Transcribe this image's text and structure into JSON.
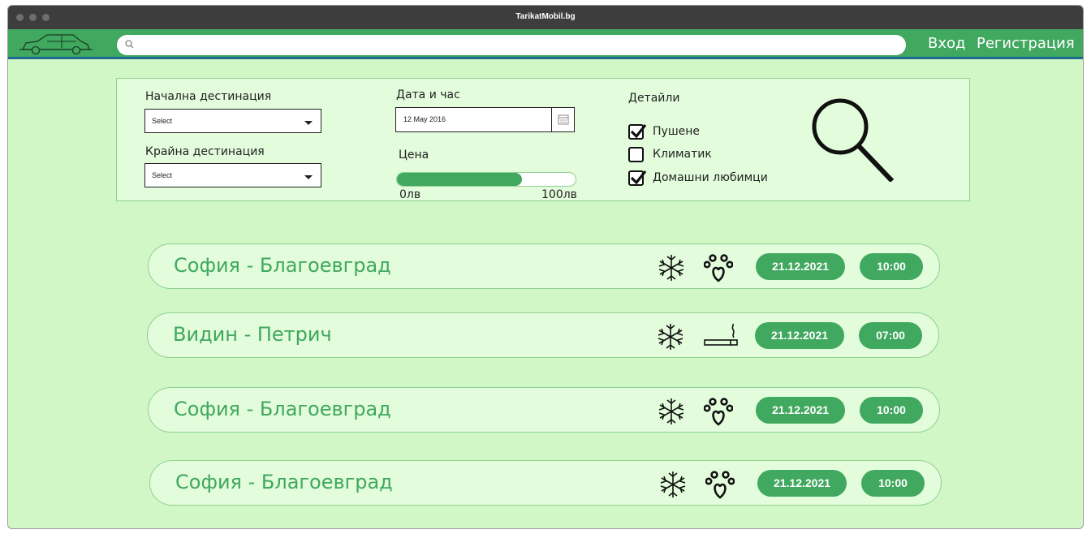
{
  "window": {
    "title": "TarikatMobil.bg"
  },
  "nav": {
    "search_placeholder": "",
    "login_label": "Вход",
    "register_label": "Регистрация"
  },
  "filters": {
    "start_label": "Начална дестинация",
    "start_value": "Select",
    "end_label": "Крайна дестинация",
    "end_value": "Select",
    "date_label": "Дата и час",
    "date_value": "12 May 2016",
    "price_label": "Цена",
    "price_min": "0лв",
    "price_max": "100лв",
    "price_fill_fraction": 0.7,
    "details_label": "Детайли",
    "details": [
      {
        "label": "Пушене",
        "checked": true
      },
      {
        "label": "Климатик",
        "checked": false
      },
      {
        "label": "Домашни любимци",
        "checked": true
      }
    ]
  },
  "rides": [
    {
      "route": "София - Благоевград",
      "icons": [
        "snowflake-icon",
        "paw-icon"
      ],
      "date": "21.12.2021",
      "time": "10:00"
    },
    {
      "route": "Видин - Петрич",
      "icons": [
        "snowflake-icon",
        "cigarette-icon"
      ],
      "date": "21.12.2021",
      "time": "07:00"
    },
    {
      "route": "София - Благоевград",
      "icons": [
        "snowflake-icon",
        "paw-icon"
      ],
      "date": "21.12.2021",
      "time": "10:00"
    },
    {
      "route": "София - Благоевград",
      "icons": [
        "snowflake-icon",
        "paw-icon"
      ],
      "date": "21.12.2021",
      "time": "10:00"
    }
  ],
  "colors": {
    "accent": "#40a85f",
    "page_bg": "#d1f7c7",
    "panel_bg": "#e3fcdc"
  }
}
